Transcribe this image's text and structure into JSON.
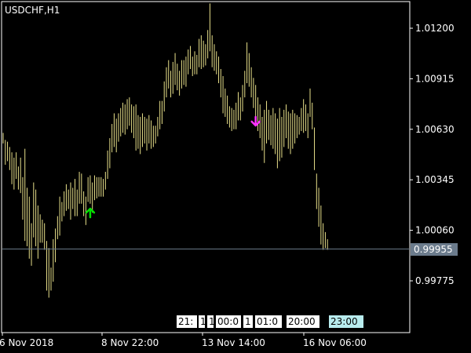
{
  "window": {
    "title": "USDCHF,H1"
  },
  "current_price": "0.99955",
  "chart_data": {
    "type": "bar",
    "title": "USDCHF,H1",
    "y_ticks": [
      "1.01200",
      "1.00915",
      "1.00630",
      "1.00345",
      "1.00060",
      "0.99775"
    ],
    "x_ticks": [
      "6 Nov 2018",
      "8 Nov 22:00",
      "13 Nov 14:00",
      "16 Nov 06:00"
    ],
    "ylim": [
      0.9966,
      1.0149
    ],
    "current_price": 0.99955,
    "bars": [
      [
        1.0061,
        1.0055
      ],
      [
        1.0057,
        1.0043
      ],
      [
        1.0056,
        1.0045
      ],
      [
        1.0053,
        1.004
      ],
      [
        1.005,
        1.0032
      ],
      [
        1.0047,
        1.0029
      ],
      [
        1.005,
        1.0035
      ],
      [
        1.0042,
        1.0029
      ],
      [
        1.0047,
        1.0027
      ],
      [
        1.0036,
        1.0012
      ],
      [
        1.0052,
        1.0
      ],
      [
        1.003,
        0.9997
      ],
      [
        1.0025,
        0.999
      ],
      [
        1.001,
        0.9986
      ],
      [
        1.0033,
        1.0002
      ],
      [
        1.0029,
        0.9997
      ],
      [
        1.002,
        0.999
      ],
      [
        1.0015,
        0.9999
      ],
      [
        1.0012,
        0.9999
      ],
      [
        1.001,
        0.9995
      ],
      [
        1.0,
        0.9972
      ],
      [
        0.9996,
        0.9968
      ],
      [
        0.9985,
        0.9972
      ],
      [
        1.0001,
        0.9977
      ],
      [
        1.0007,
        0.9988
      ],
      [
        1.0014,
        1.0001
      ],
      [
        1.0025,
        1.0003
      ],
      [
        1.0022,
        1.0011
      ],
      [
        1.0028,
        1.0014
      ],
      [
        1.0032,
        1.0017
      ],
      [
        1.0029,
        1.0018
      ],
      [
        1.0033,
        1.0012
      ],
      [
        1.003,
        1.0018
      ],
      [
        1.0035,
        1.0014
      ],
      [
        1.0029,
        1.0014
      ],
      [
        1.0039,
        1.0021
      ],
      [
        1.0038,
        1.0021
      ],
      [
        1.0028,
        1.0014
      ],
      [
        1.0025,
        1.0009
      ],
      [
        1.0036,
        1.0022
      ],
      [
        1.0037,
        1.0021
      ],
      [
        1.0033,
        1.0016
      ],
      [
        1.0037,
        1.0023
      ],
      [
        1.0036,
        1.0024
      ],
      [
        1.0036,
        1.0025
      ],
      [
        1.0036,
        1.0025
      ],
      [
        1.0035,
        1.0025
      ],
      [
        1.0039,
        1.0029
      ],
      [
        1.0051,
        1.0035
      ],
      [
        1.0058,
        1.0041
      ],
      [
        1.0066,
        1.005
      ],
      [
        1.0072,
        1.0053
      ],
      [
        1.0069,
        1.005
      ],
      [
        1.0072,
        1.0056
      ],
      [
        1.0075,
        1.0059
      ],
      [
        1.0078,
        1.0061
      ],
      [
        1.0077,
        1.006
      ],
      [
        1.008,
        1.0063
      ],
      [
        1.0081,
        1.0065
      ],
      [
        1.0077,
        1.0061
      ],
      [
        1.0076,
        1.0058
      ],
      [
        1.0077,
        1.0051
      ],
      [
        1.0071,
        1.0052
      ],
      [
        1.007,
        1.0049
      ],
      [
        1.0072,
        1.0053
      ],
      [
        1.007,
        1.0055
      ],
      [
        1.0069,
        1.0051
      ],
      [
        1.0071,
        1.0055
      ],
      [
        1.0068,
        1.0052
      ],
      [
        1.0065,
        1.0053
      ],
      [
        1.0065,
        1.0055
      ],
      [
        1.007,
        1.0059
      ],
      [
        1.0079,
        1.0063
      ],
      [
        1.0079,
        1.0066
      ],
      [
        1.009,
        1.0073
      ],
      [
        1.0098,
        1.0081
      ],
      [
        1.0102,
        1.0086
      ],
      [
        1.0096,
        1.0081
      ],
      [
        1.0101,
        1.0083
      ],
      [
        1.0106,
        1.0088
      ],
      [
        1.01,
        1.0085
      ],
      [
        1.0096,
        1.0082
      ],
      [
        1.0102,
        1.0086
      ],
      [
        1.0102,
        1.0088
      ],
      [
        1.0104,
        1.0087
      ],
      [
        1.0108,
        1.0094
      ],
      [
        1.011,
        1.0097
      ],
      [
        1.0104,
        1.0093
      ],
      [
        1.0107,
        1.0094
      ],
      [
        1.0105,
        1.0094
      ],
      [
        1.0114,
        1.0098
      ],
      [
        1.0116,
        1.0097
      ],
      [
        1.0113,
        1.0098
      ],
      [
        1.0111,
        1.0099
      ],
      [
        1.0119,
        1.0103
      ],
      [
        1.0134,
        1.0107
      ],
      [
        1.0116,
        1.0098
      ],
      [
        1.0111,
        1.0096
      ],
      [
        1.0107,
        1.0094
      ],
      [
        1.0104,
        1.0089
      ],
      [
        1.0097,
        1.0081
      ],
      [
        1.0093,
        1.0072
      ],
      [
        1.0086,
        1.007
      ],
      [
        1.0082,
        1.0066
      ],
      [
        1.0076,
        1.0064
      ],
      [
        1.0075,
        1.0062
      ],
      [
        1.0074,
        1.0063
      ],
      [
        1.0078,
        1.0063
      ],
      [
        1.0084,
        1.0068
      ],
      [
        1.0081,
        1.0068
      ],
      [
        1.0088,
        1.0073
      ],
      [
        1.0096,
        1.0081
      ],
      [
        1.0112,
        1.0089
      ],
      [
        1.0106,
        1.0087
      ],
      [
        1.0098,
        1.0081
      ],
      [
        1.0092,
        1.0075
      ],
      [
        1.0088,
        1.0067
      ],
      [
        1.0081,
        1.0062
      ],
      [
        1.0077,
        1.0058
      ],
      [
        1.007,
        1.0051
      ],
      [
        1.0074,
        1.0044
      ],
      [
        1.0079,
        1.0055
      ],
      [
        1.0074,
        1.0057
      ],
      [
        1.0071,
        1.0054
      ],
      [
        1.0075,
        1.0052
      ],
      [
        1.0072,
        1.0049
      ],
      [
        1.0069,
        1.0041
      ],
      [
        1.0075,
        1.0045
      ],
      [
        1.007,
        1.0047
      ],
      [
        1.0074,
        1.0053
      ],
      [
        1.0077,
        1.0058
      ],
      [
        1.0073,
        1.0052
      ],
      [
        1.0072,
        1.0049
      ],
      [
        1.0074,
        1.0052
      ],
      [
        1.0072,
        1.0055
      ],
      [
        1.0071,
        1.0058
      ],
      [
        1.007,
        1.006
      ],
      [
        1.0075,
        1.0062
      ],
      [
        1.008,
        1.0061
      ],
      [
        1.0077,
        1.0062
      ],
      [
        1.0072,
        1.0058
      ],
      [
        1.0086,
        1.007
      ],
      [
        1.0078,
        1.0063
      ],
      [
        1.0064,
        1.004
      ],
      [
        1.0038,
        1.0018
      ],
      [
        1.003,
        1.0008
      ],
      [
        1.002,
        0.9998
      ],
      [
        1.001,
        0.9995
      ],
      [
        1.0005,
        0.9996
      ],
      [
        1.0001,
        0.9995
      ]
    ],
    "buy_arrow": {
      "bar": 40,
      "price": 1.0017
    },
    "sell_arrow": {
      "bar": 116,
      "price": 1.0067
    }
  },
  "colors": {
    "background": "#000000",
    "bars": "#e8e08a",
    "axis": "#ffffff",
    "grid_line": "#6b7b8c",
    "buy_arrow": "#00e000",
    "sell_arrow": "#ff33ff",
    "time_box": "#ffffff",
    "time_box_highlight": "#b8ecee"
  },
  "session_labels": [
    "21:",
    "1",
    "1",
    "00:0",
    "1",
    "01:0",
    "20:00",
    "23:00"
  ]
}
